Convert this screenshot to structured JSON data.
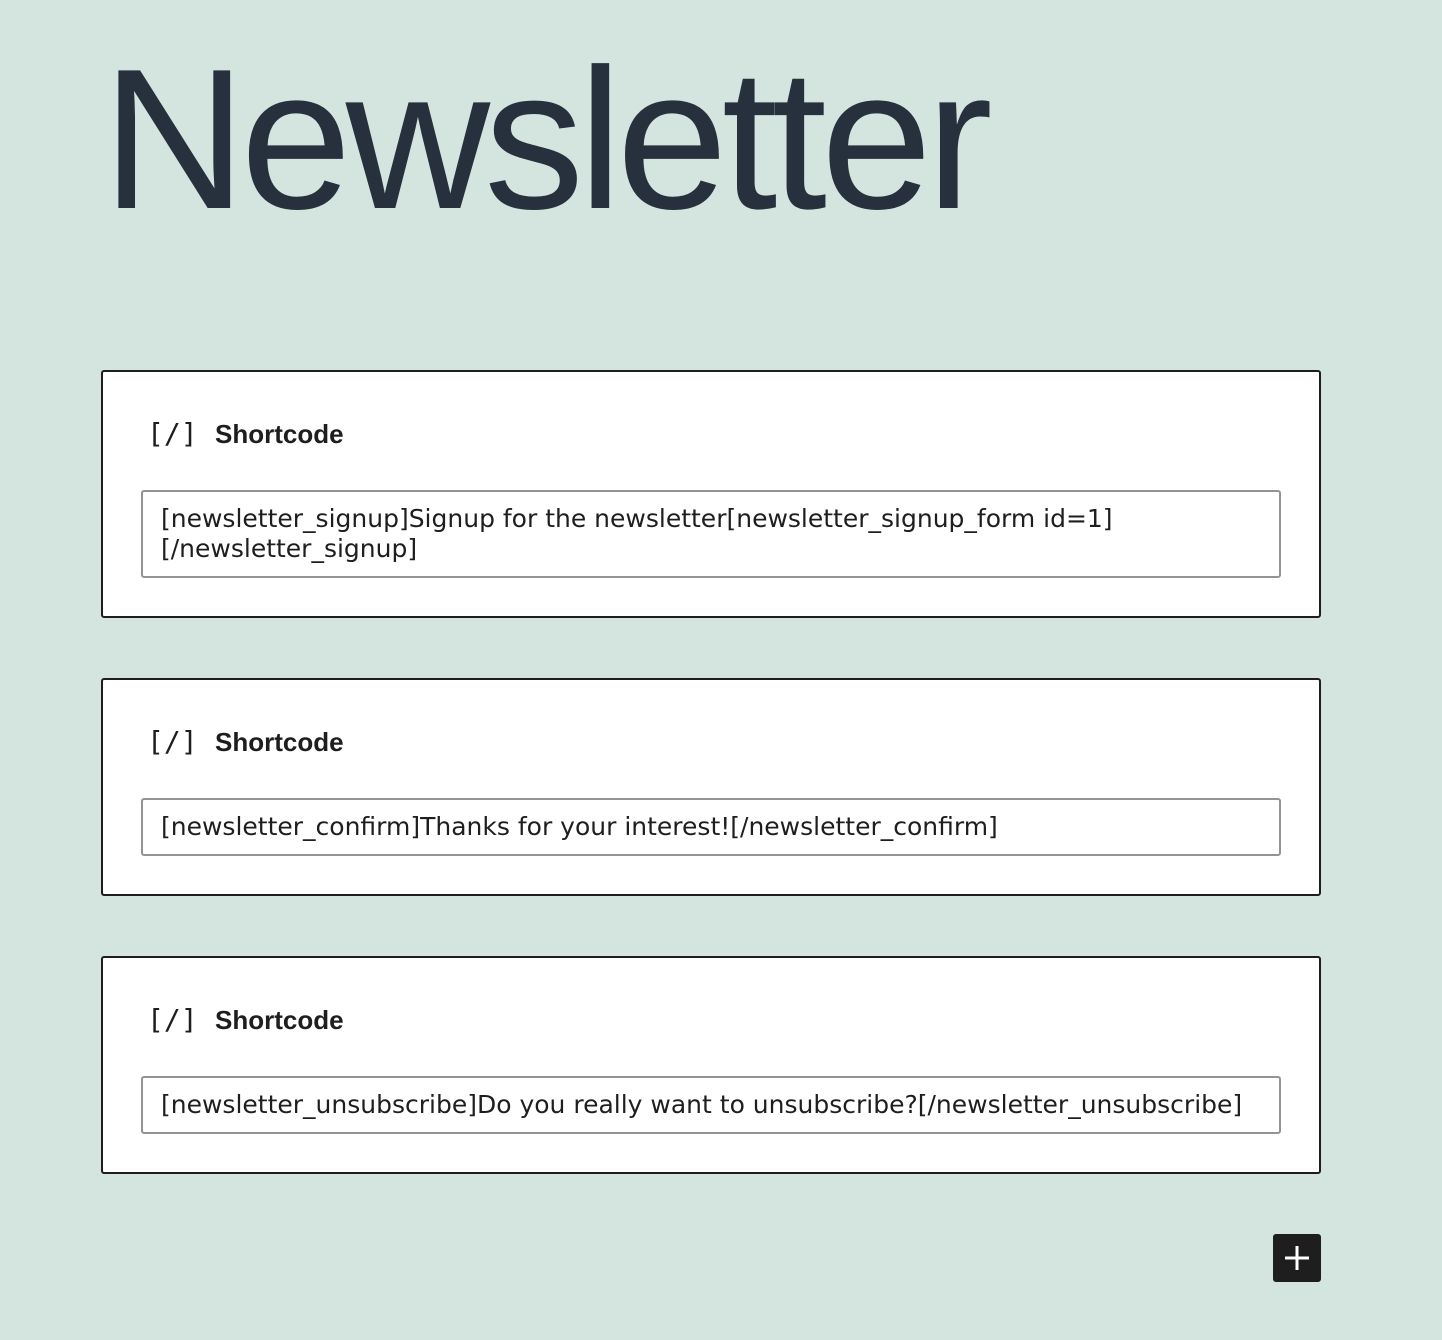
{
  "page": {
    "title": "Newsletter"
  },
  "blocks": [
    {
      "icon": "shortcode-icon",
      "icon_glyph": "[/]",
      "label": "Shortcode",
      "value": "[newsletter_signup]Signup for the newsletter[newsletter_signup_form id=1][/newsletter_signup]"
    },
    {
      "icon": "shortcode-icon",
      "icon_glyph": "[/]",
      "label": "Shortcode",
      "value": "[newsletter_confirm]Thanks for your interest![/newsletter_confirm]"
    },
    {
      "icon": "shortcode-icon",
      "icon_glyph": "[/]",
      "label": "Shortcode",
      "value": "[newsletter_unsubscribe]Do you really want to unsubscribe?[/newsletter_unsubscribe]"
    }
  ],
  "add_block": {
    "icon": "plus-icon"
  },
  "colors": {
    "background": "#d4e4df",
    "title_text": "#27303d",
    "block_border": "#1e1e1e",
    "field_border": "#949494",
    "add_button": "#1e1e1e"
  }
}
